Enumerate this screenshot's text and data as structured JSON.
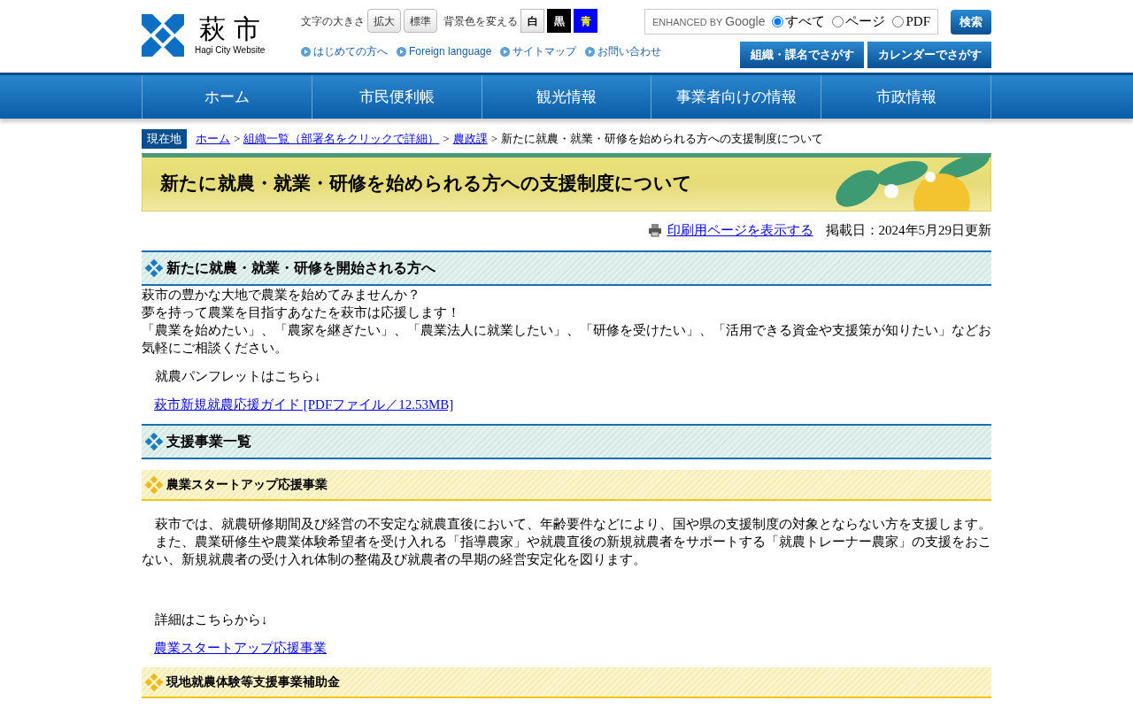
{
  "header": {
    "logo": {
      "title": "萩 市",
      "subtitle": "Hagi City Website"
    },
    "text_size": {
      "label": "文字の大きさ",
      "buttons": [
        "拡大",
        "標準"
      ]
    },
    "bg_color": {
      "label": "背景色を変える",
      "buttons": [
        {
          "label": "白",
          "kind": "white"
        },
        {
          "label": "黒",
          "kind": "black"
        },
        {
          "label": "青",
          "kind": "blue"
        }
      ]
    },
    "quick_links": [
      "はじめての方へ",
      "Foreign language",
      "サイトマップ",
      "お問い合わせ"
    ],
    "search": {
      "brand_prefix": "ENHANCED BY",
      "brand": "Google",
      "options": [
        {
          "label": "すべて",
          "selected": true
        },
        {
          "label": "ページ",
          "selected": false
        },
        {
          "label": "PDF",
          "selected": false
        }
      ],
      "button": "検索"
    },
    "find_buttons": [
      "組織・課名でさがす",
      "カレンダーでさがす"
    ]
  },
  "nav": [
    "ホーム",
    "市民便利帳",
    "観光情報",
    "事業者向けの情報",
    "市政情報"
  ],
  "breadcrumb": {
    "badge": "現在地",
    "separator": ">",
    "items": [
      {
        "label": "ホーム",
        "link": true
      },
      {
        "label": "組織一覧（部署名をクリックで詳細）",
        "link": true
      },
      {
        "label": "農政課",
        "link": true
      },
      {
        "label": "新たに就農・就業・研修を始められる方への支援制度について",
        "link": false
      }
    ]
  },
  "page_title": "新たに就農・就業・研修を始められる方への支援制度について",
  "print_link": "印刷用ページを表示する",
  "date": "掲載日：2024年5月29日更新",
  "blocks": [
    {
      "kind": "h2",
      "text": "新たに就農・就業・研修を開始される方へ"
    },
    {
      "kind": "lines",
      "lines": [
        "萩市の豊かな大地で農業を始めてみませんか？",
        "夢を持って農業を目指すあなたを萩市は応援します！",
        "「農業を始めたい」、「農家を継ぎたい」、「農業法人に就業したい」、「研修を受けたい」、「活用できる資金や支援策が知りたい」などお気軽にご相談ください。"
      ]
    },
    {
      "kind": "text",
      "text": "就農パンフレットはこちら↓",
      "indent": true
    },
    {
      "kind": "link",
      "text": "萩市新規就農応援ガイド [PDFファイル／12.53MB]"
    },
    {
      "kind": "h2",
      "text": "支援事業一覧"
    },
    {
      "kind": "h3",
      "text": "農業スタートアップ応援事業"
    },
    {
      "kind": "lines",
      "indent": true,
      "lines": [
        "萩市では、就農研修期間及び経営の不安定な就農直後において、年齢要件などにより、国や県の支援制度の対象とならない方を支援します。",
        "また、農業研修生や農業体験希望者を受け入れる「指導農家」や就農直後の新規就農者をサポートする「就農トレーナー農家」の支援をおこない、新規就農者の受け入れ体制の整備及び就農者の早期の経営安定化を図ります。"
      ]
    },
    {
      "kind": "text",
      "text": "詳細はこちらから↓",
      "indent": true
    },
    {
      "kind": "link",
      "text": "農業スタートアップ応援事業"
    },
    {
      "kind": "h3",
      "text": "現地就農体験等支援事業補助金"
    }
  ]
}
